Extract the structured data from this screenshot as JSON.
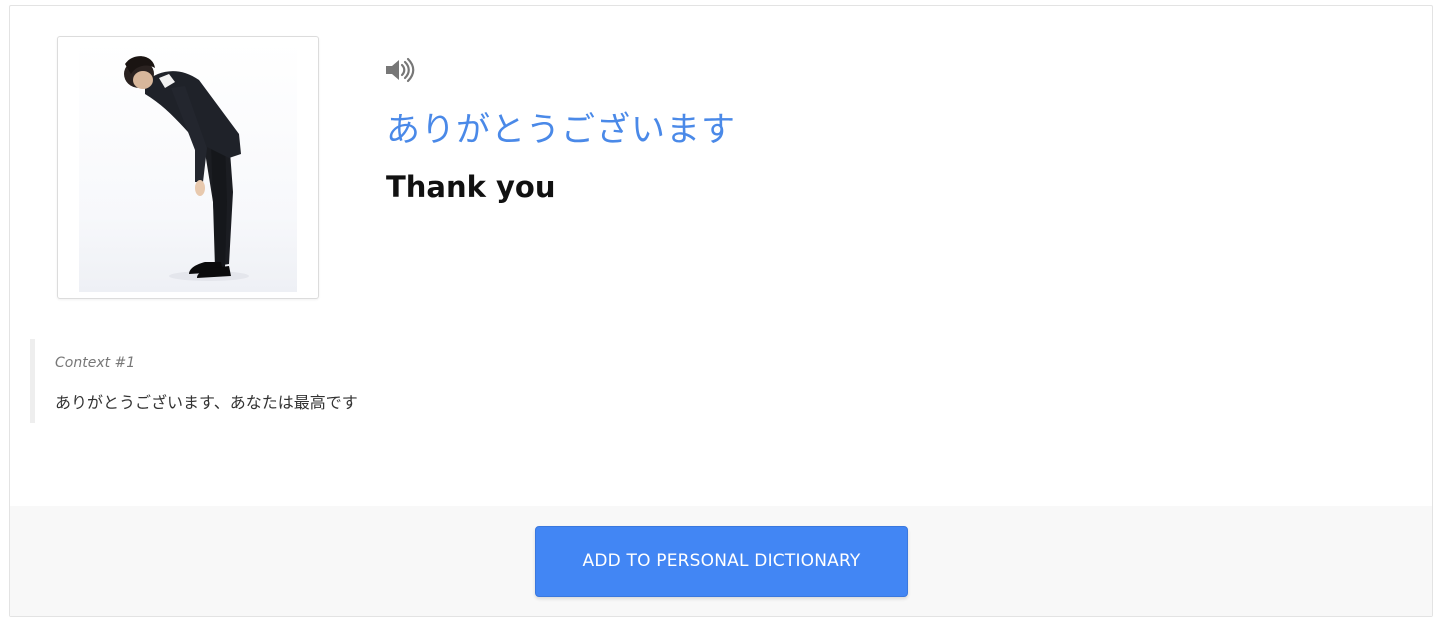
{
  "term": {
    "word": "ありがとうございます",
    "meaning": "Thank you",
    "audio_icon": "speaker-volume-icon"
  },
  "image": {
    "description_icon": "bowing-man-photo"
  },
  "context": {
    "label": "Context #1",
    "sentence": "ありがとうございます、あなたは最高です"
  },
  "actions": {
    "add_label": "ADD TO PERSONAL DICTIONARY"
  },
  "colors": {
    "accent": "#4a89e8",
    "button": "#4286f4",
    "footer_bg": "#f8f8f8"
  }
}
